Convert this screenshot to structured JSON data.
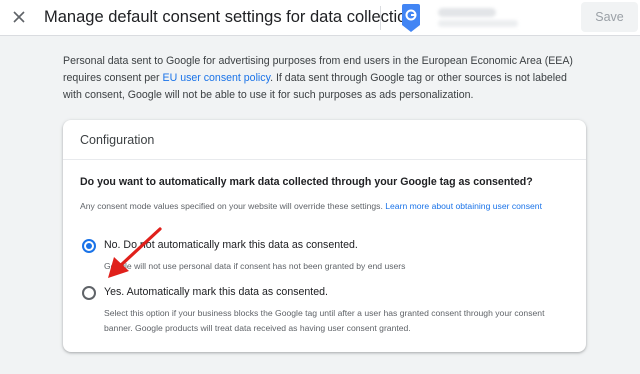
{
  "header": {
    "title": "Manage default consent settings for data collection",
    "save_label": "Save"
  },
  "intro": {
    "text_before": "Personal data sent to Google for advertising purposes from end users in the European Economic Area (EEA) requires consent per ",
    "link": "EU user consent policy",
    "text_after": ". If data sent through Google tag or other sources is not labeled with consent, Google will not be able to use it for such purposes as ads personalization."
  },
  "card": {
    "title": "Configuration",
    "question": "Do you want to automatically mark data collected through your Google tag as consented?",
    "hint_text": "Any consent mode values specified on your website will override these settings. ",
    "hint_link": "Learn more about obtaining user consent",
    "options": [
      {
        "label": "No. Do not automatically mark this data as consented.",
        "description": "Google will not use personal data if consent has not been granted by end users",
        "selected": true
      },
      {
        "label": "Yes. Automatically mark this data as consented.",
        "description": "Select this option if your business blocks the Google tag until after a user has granted consent through your consent banner. Google products will treat data received as having user consent granted.",
        "selected": false
      }
    ]
  },
  "colors": {
    "accent": "#1a73e8",
    "annotation_arrow": "#e0201b",
    "tag_icon": "#4285f4"
  },
  "icons": {
    "close": "close-icon",
    "tag": "google-tag-icon",
    "arrow": "annotation-arrow"
  }
}
